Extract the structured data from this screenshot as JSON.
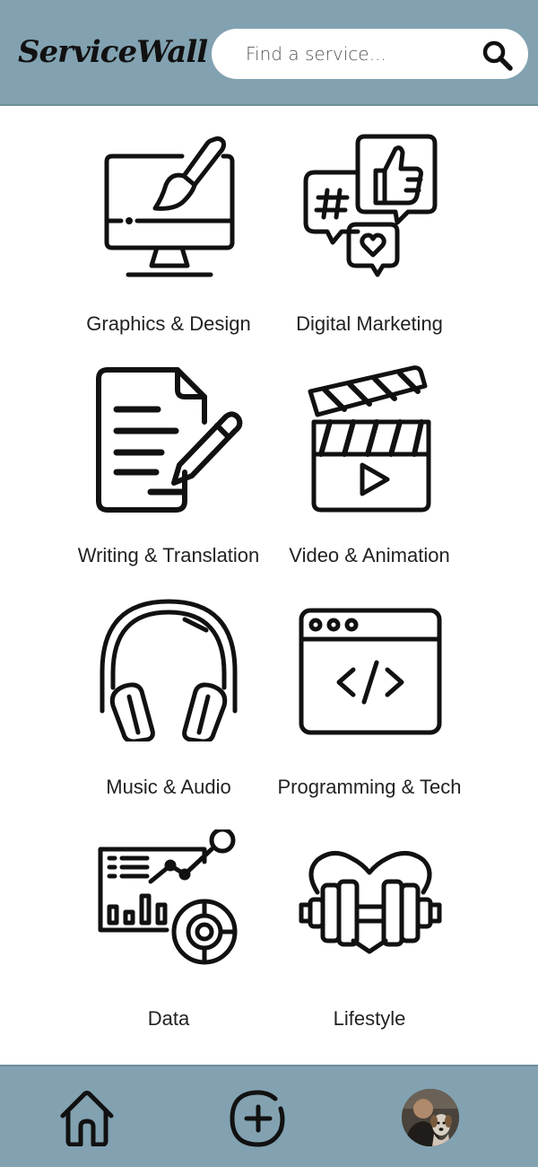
{
  "header": {
    "logo": "ServiceWall",
    "search_placeholder": "Find a service...",
    "search_icon": "search-icon"
  },
  "categories": [
    {
      "label": "Graphics & Design",
      "icon": "monitor-paintbrush-icon"
    },
    {
      "label": "Digital Marketing",
      "icon": "social-bubbles-icon"
    },
    {
      "label": "Writing & Translation",
      "icon": "document-pencil-icon"
    },
    {
      "label": "Video & Animation",
      "icon": "clapperboard-icon"
    },
    {
      "label": "Music & Audio",
      "icon": "headphones-icon"
    },
    {
      "label": "Programming & Tech",
      "icon": "code-window-icon"
    },
    {
      "label": "Data",
      "icon": "analytics-chart-icon"
    },
    {
      "label": "Lifestyle",
      "icon": "heart-dumbbell-icon"
    }
  ],
  "bottom_nav": {
    "items": [
      {
        "icon": "home-icon"
      },
      {
        "icon": "add-circle-icon"
      },
      {
        "icon": "avatar"
      }
    ]
  },
  "colors": {
    "bar_background": "#82a2b1",
    "icon_stroke": "#111111"
  }
}
